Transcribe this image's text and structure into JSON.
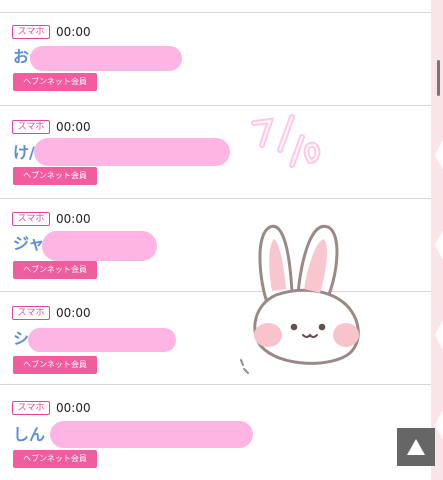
{
  "entries": [
    {
      "device": "スマホ",
      "time": "00:00",
      "name": "おー",
      "badge": "ヘブンネット会員"
    },
    {
      "device": "スマホ",
      "time": "00:00",
      "name": "け/",
      "badge": "ヘブンネット会員"
    },
    {
      "device": "スマホ",
      "time": "00:00",
      "name": "ジャ",
      "badge": "ヘブンネット会員"
    },
    {
      "device": "スマホ",
      "time": "00:00",
      "name": "シ",
      "badge": "ヘブンネット会員"
    },
    {
      "device": "スマホ",
      "time": "00:00",
      "name": "しん",
      "badge": "ヘブンネット会員"
    }
  ],
  "sticker": {
    "handwriting": "7/10"
  },
  "colors": {
    "accent_pink": "#f05c9e",
    "badge_outline": "#e0479a",
    "name_blue": "#5b8fd6",
    "scribble": "#ffb3e2",
    "sidebar": "#fbe4e7"
  },
  "icons": {
    "scroll_top": "triangle-up-icon"
  }
}
